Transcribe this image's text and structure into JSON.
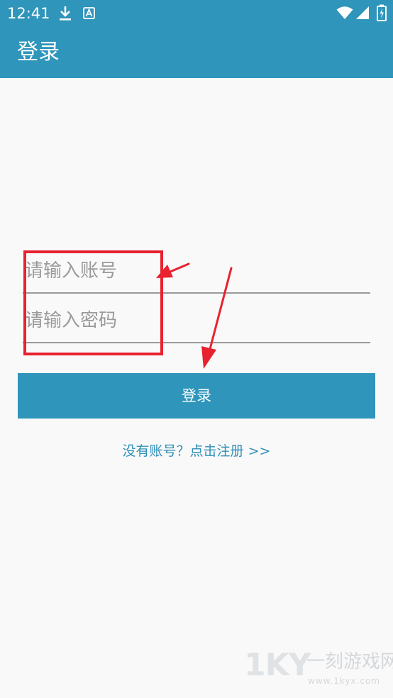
{
  "status_bar": {
    "time": "12:41",
    "icons": [
      "download-icon",
      "font-a-icon",
      "wifi-icon",
      "signal-icon",
      "battery-icon"
    ]
  },
  "app_bar": {
    "title": "登录"
  },
  "form": {
    "account_placeholder": "请输入账号",
    "password_placeholder": "请输入密码",
    "login_button": "登录",
    "register_link": "没有账号？点击注册 >>"
  },
  "watermark": {
    "logo": "1KY",
    "name": "一刻游戏网",
    "url": "www.1kyx.com"
  },
  "colors": {
    "primary": "#2f95bb",
    "background": "#f9f9f9",
    "annotation": "#e8222f",
    "link": "#2f8fb7",
    "underline": "#9a9a9a"
  }
}
